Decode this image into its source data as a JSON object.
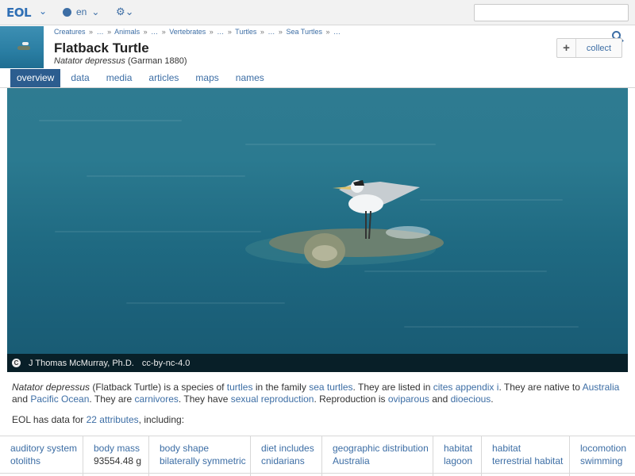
{
  "topbar": {
    "logo": "EOL",
    "language": "en",
    "search_placeholder": ""
  },
  "header": {
    "breadcrumbs": [
      "Creatures",
      "»",
      "…",
      "»",
      "Animals",
      "»",
      "…",
      "»",
      "Vertebrates",
      "»",
      "…",
      "»",
      "Turtles",
      "»",
      "…",
      "»",
      "Sea Turtles",
      "»",
      "…"
    ],
    "title": "Flatback Turtle",
    "scientific_name": "Natator depressus",
    "authority": "(Garman 1880)",
    "collect_label": "collect",
    "collect_plus": "+"
  },
  "tabs": [
    {
      "label": "overview",
      "active": true
    },
    {
      "label": "data",
      "active": false
    },
    {
      "label": "media",
      "active": false
    },
    {
      "label": "articles",
      "active": false
    },
    {
      "label": "maps",
      "active": false
    },
    {
      "label": "names",
      "active": false
    }
  ],
  "hero": {
    "credit_icon": "C",
    "credit_author": "J Thomas McMurray, Ph.D.",
    "credit_license": "cc-by-nc-4.0"
  },
  "description": {
    "p1_sci": "Natator depressus",
    "p1_a": " (Flatback Turtle) is a species of ",
    "link_turtles": "turtles",
    "p1_b": " in the family ",
    "link_sea_turtles": "sea turtles",
    "p1_c": ". They are listed in ",
    "link_cites": "cites appendix i",
    "p1_d": ". They are native to ",
    "link_australia": "Australia",
    "p1_e": " and ",
    "link_pacific": "Pacific Ocean",
    "p1_f": ". They are ",
    "link_carnivores": "carnivores",
    "p1_g": ". They have ",
    "link_sexual": "sexual reproduction",
    "p1_h": ". Reproduction is ",
    "link_oviparous": "oviparous",
    "p1_i": " and ",
    "link_dioecious": "dioecious",
    "p1_j": ".",
    "attr_prefix": "EOL has data for ",
    "attr_link": "22 attributes",
    "attr_suffix": ", including:"
  },
  "attributes": [
    {
      "key": "auditory system",
      "value": "otoliths",
      "value_is_link": true
    },
    {
      "key": "body mass",
      "value": "93554.48 g",
      "value_is_link": false
    },
    {
      "key": "body shape",
      "value": "bilaterally symmetric",
      "value_is_link": true
    },
    {
      "key": "diet includes",
      "value": "cnidarians",
      "value_is_link": true
    },
    {
      "key": "geographic distribution",
      "value": "Australia",
      "value_is_link": true
    },
    {
      "key": "habitat",
      "value": "lagoon",
      "value_is_link": true
    },
    {
      "key": "habitat",
      "value": "terrestrial habitat",
      "value_is_link": true
    },
    {
      "key": "locomotion",
      "value": "swimming",
      "value_is_link": true
    }
  ]
}
